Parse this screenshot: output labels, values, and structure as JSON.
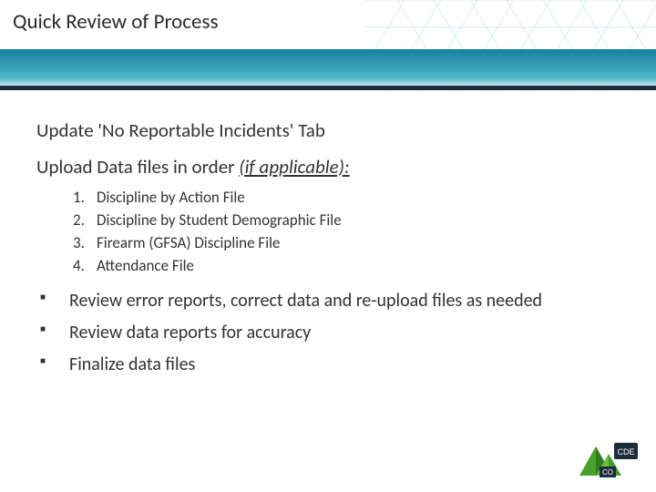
{
  "title": "Quick Review of Process",
  "headline1": "Update 'No Reportable Incidents' Tab",
  "headline2_prefix": "Upload Data files in order ",
  "headline2_italic": "(if applicable):",
  "numbered": [
    "Discipline by Action File",
    "Discipline by Student Demographic File",
    "Firearm (GFSA) Discipline File",
    "Attendance File"
  ],
  "bullets": [
    "Review error reports, correct data and re-upload files as needed",
    "Review data reports for accuracy",
    "Finalize data files"
  ],
  "logo_badge": "CDE",
  "logo_state": "CO"
}
